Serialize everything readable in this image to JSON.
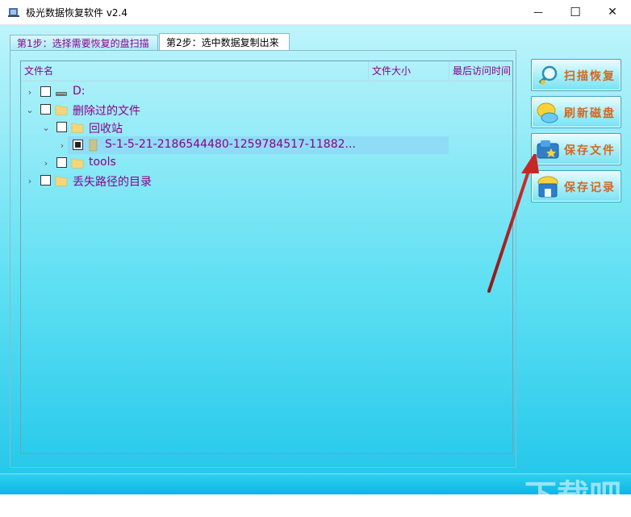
{
  "window": {
    "title": "极光数据恢复软件 v2.4",
    "minimize_glyph": "—",
    "maximize_glyph": "☐",
    "close_glyph": "✕"
  },
  "tabs": [
    {
      "label": "第1步：选择需要恢复的盘扫描",
      "active": false
    },
    {
      "label": "第2步：选中数据复制出来",
      "active": true
    }
  ],
  "tree": {
    "columns": [
      "文件名",
      "文件大小",
      "最后访问时间"
    ],
    "rows": [
      {
        "label": "D:",
        "expander": "›",
        "checked": false,
        "icon": "drive-icon"
      },
      {
        "label": "删除过的文件",
        "expander": "⌄",
        "checked": false,
        "icon": "folder-icon"
      },
      {
        "label": "回收站",
        "expander": "⌄",
        "checked": false,
        "icon": "folder-icon"
      },
      {
        "label": "S-1-5-21-2186544480-1259784517-11882...",
        "expander": "›",
        "checked": "partial",
        "icon": "folder-icon",
        "selected": true
      },
      {
        "label": "tools",
        "expander": "›",
        "checked": false,
        "icon": "folder-icon"
      },
      {
        "label": "丢失路径的目录",
        "expander": "›",
        "checked": false,
        "icon": "folder-icon"
      }
    ]
  },
  "scrollbar": {
    "left_arrow": "◀",
    "right_arrow": "▶"
  },
  "actions": [
    {
      "label": "扫描恢复",
      "icon": "magnifier-icon"
    },
    {
      "label": "刷新磁盘",
      "icon": "refresh-disk-icon"
    },
    {
      "label": "保存文件",
      "icon": "save-file-icon"
    },
    {
      "label": "保存记录",
      "icon": "save-record-icon"
    }
  ],
  "watermark": {
    "text": "下载吧",
    "url": "www.xiazaiba.com"
  },
  "colors": {
    "accent_purple": "#8b008b",
    "button_text": "#d2691e",
    "annotation_arrow": "#b22222"
  }
}
